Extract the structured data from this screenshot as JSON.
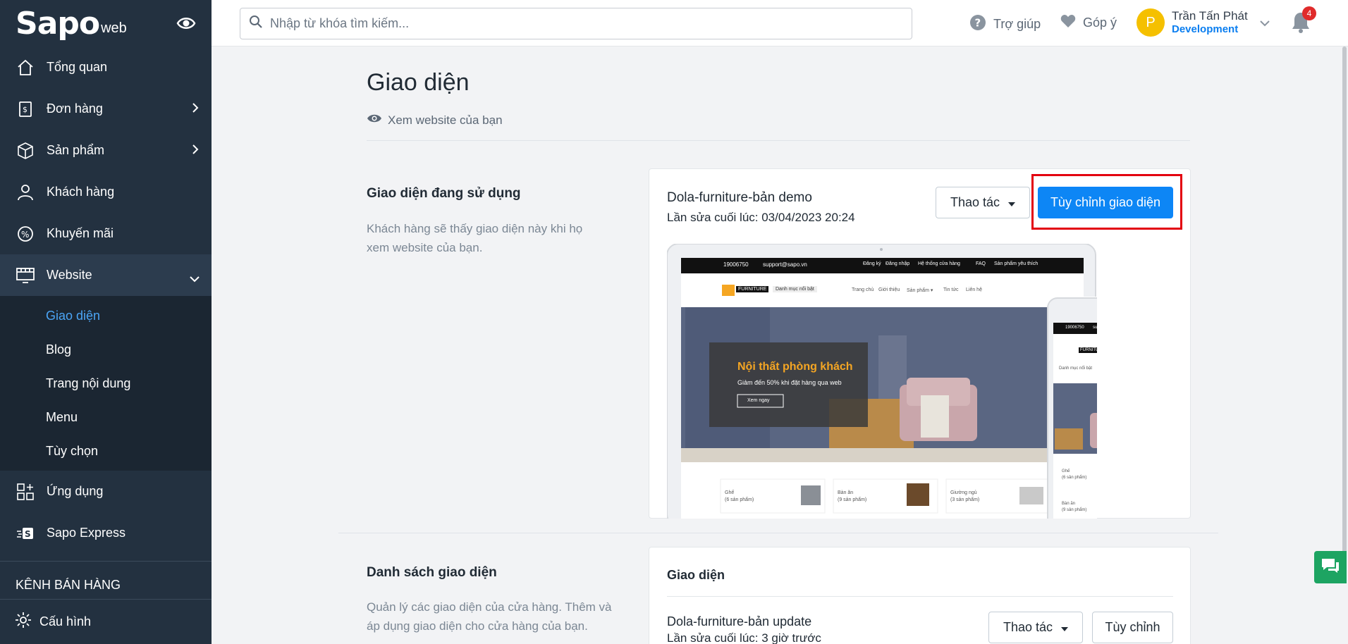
{
  "sidebar": {
    "brand": "Sapo",
    "brand_suffix": "web",
    "items": [
      {
        "label": "Tổng quan"
      },
      {
        "label": "Đơn hàng"
      },
      {
        "label": "Sản phẩm"
      },
      {
        "label": "Khách hàng"
      },
      {
        "label": "Khuyến mãi"
      },
      {
        "label": "Website"
      }
    ],
    "website_sub": [
      "Giao diện",
      "Blog",
      "Trang nội dung",
      "Menu",
      "Tùy chọn"
    ],
    "apps": "Ứng dụng",
    "express": "Sapo Express",
    "channels": "KÊNH BÁN HÀNG",
    "settings": "Cấu hình"
  },
  "topbar": {
    "search_placeholder": "Nhập từ khóa tìm kiếm...",
    "help": "Trợ giúp",
    "feedback": "Góp ý",
    "user_name": "Trần Tấn Phát",
    "user_role": "Development",
    "avatar_letter": "P",
    "notifications": "4"
  },
  "page": {
    "title": "Giao diện",
    "view_site": "Xem website của bạn"
  },
  "current_theme": {
    "section_title": "Giao diện đang sử dụng",
    "section_desc": "Khách hàng sẽ thấy giao diện này khi họ xem website của bạn.",
    "name": "Dola-furniture-bản demo",
    "last_edited": "Lần sửa cuối lúc: 03/04/2023 20:24",
    "actions_label": "Thao tác",
    "customize_label": "Tùy chỉnh giao diện"
  },
  "preview": {
    "phone": "19006750",
    "email": "support@sapo.vn",
    "top_links": [
      "Đăng ký",
      "Đăng nhập",
      "Hệ thống cửa hàng",
      "FAQ",
      "Sản phẩm yêu thích"
    ],
    "logo_text": "FURNITURE",
    "menu_label": "Danh mục nổi bật",
    "nav": [
      "Trang chủ",
      "Giới thiệu",
      "Sản phẩm ▾",
      "Tin tức",
      "Liên hệ"
    ],
    "hero_title": "Nội thất phòng khách",
    "hero_sub": "Giảm đến 50% khi đặt hàng qua web",
    "hero_btn": "Xem ngay",
    "categories": [
      {
        "name": "Ghế",
        "count": "(6 sản phẩm)"
      },
      {
        "name": "Bàn ăn",
        "count": "(9 sản phẩm)"
      },
      {
        "name": "Giường ngủ",
        "count": "(3 sản phẩm)"
      }
    ]
  },
  "theme_list": {
    "section_title": "Danh sách giao diện",
    "section_desc": "Quản lý các giao diện của cửa hàng. Thêm và áp dụng giao diện cho cửa hàng của bạn.",
    "card_title": "Giao diện",
    "item_name": "Dola-furniture-bản update",
    "item_time": "Lần sửa cuối lúc: 3 giờ trước",
    "actions_label": "Thao tác",
    "customize_label": "Tùy chỉnh"
  },
  "colors": {
    "sidebar_bg": "#233140",
    "accent": "#0d86f5",
    "highlight_box": "#e3000f"
  }
}
